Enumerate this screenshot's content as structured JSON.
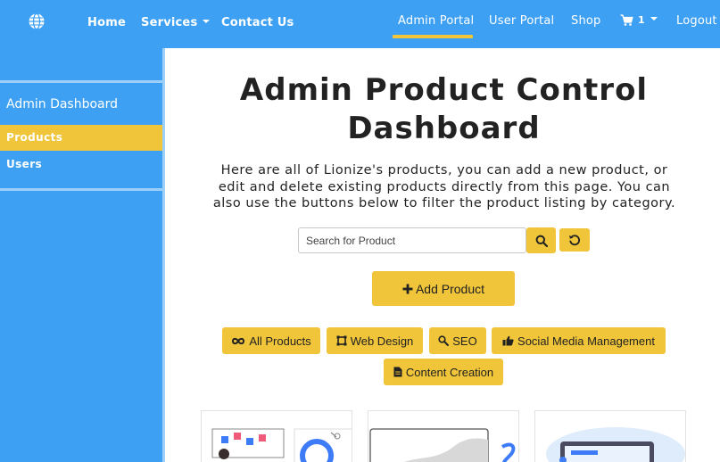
{
  "navbar": {
    "logo_icon": "globe-icon",
    "links": {
      "home": "Home",
      "services": "Services",
      "contact": "Contact Us",
      "admin_portal": "Admin Portal",
      "user_portal": "User Portal",
      "shop": "Shop",
      "cart_count": "1",
      "logout": "Logout"
    },
    "cart_icon": "cart-icon",
    "accent_color": "#f0c53a",
    "bar_color": "#3ea0f2"
  },
  "sidebar": {
    "title": "Admin Dashboard",
    "items": [
      {
        "label": "Products",
        "active": true
      },
      {
        "label": "Users",
        "active": false
      }
    ]
  },
  "main": {
    "title": "Admin Product Control Dashboard",
    "description": "Here are all of Lionize's products, you can add a new product, or edit and delete existing products directly from this page. You can also use the buttons below to filter the product listing by category.",
    "search": {
      "placeholder": "Search for Product",
      "value": ""
    },
    "add_product_label": "Add Product",
    "filters": [
      {
        "label": "All Products",
        "icon": "infinity-icon"
      },
      {
        "label": "Web Design",
        "icon": "web-design-icon"
      },
      {
        "label": "SEO",
        "icon": "magnify-icon"
      },
      {
        "label": "Social Media Management",
        "icon": "thumbs-up-icon"
      },
      {
        "label": "Content Creation",
        "icon": "document-icon"
      }
    ]
  }
}
